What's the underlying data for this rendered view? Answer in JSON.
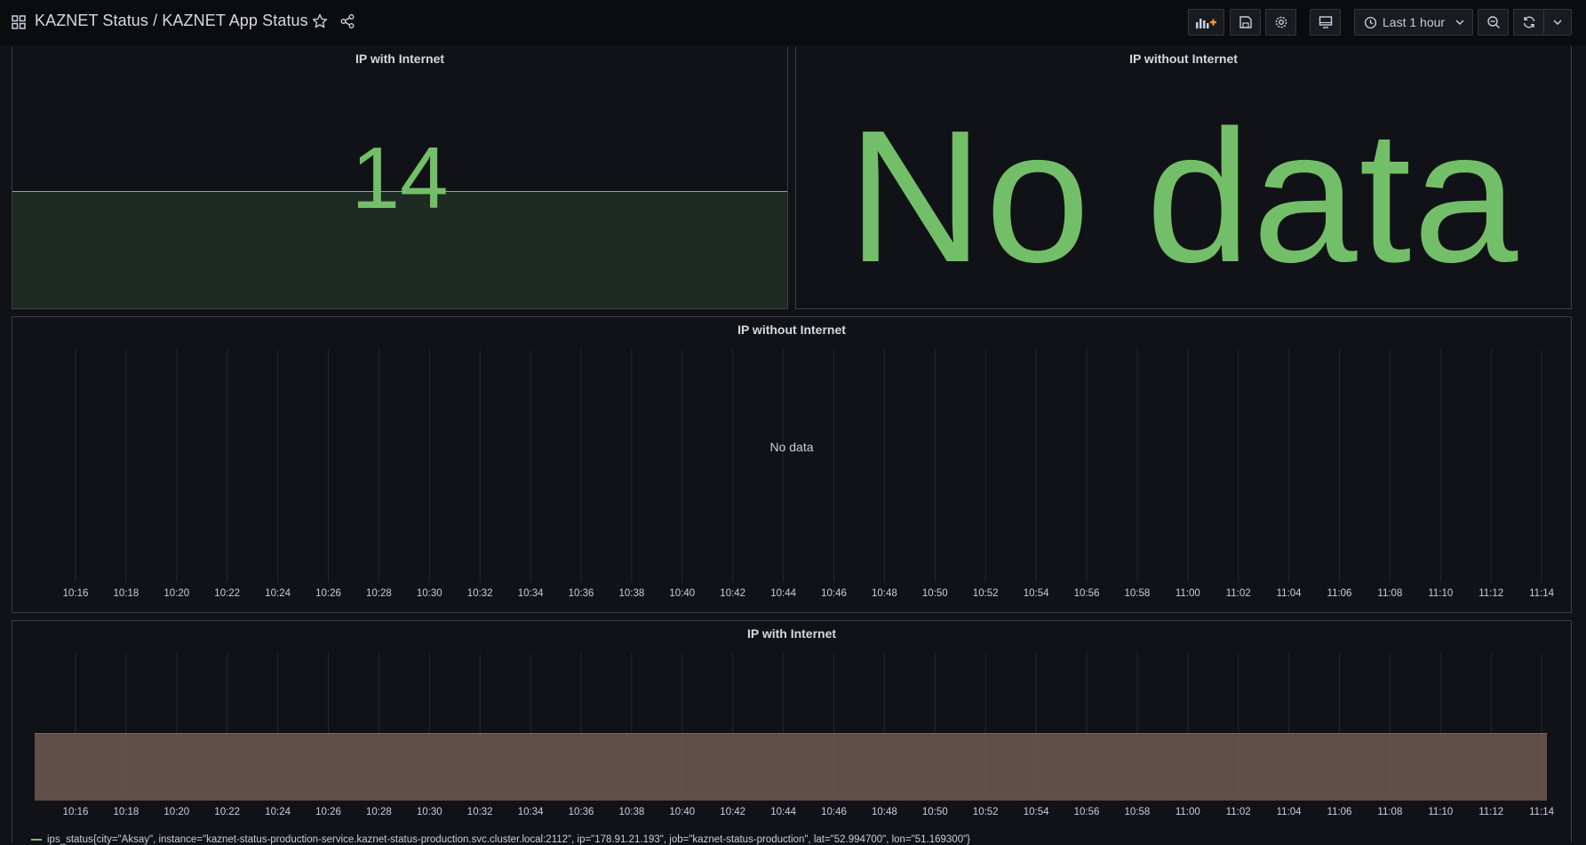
{
  "header": {
    "title": "KAZNET Status / KAZNET App Status",
    "time_range_label": "Last 1 hour",
    "icons": [
      "apps-grid-icon",
      "star-icon",
      "share-icon",
      "add-panel-icon",
      "save-icon",
      "gear-icon",
      "tv-mode-icon",
      "clock-icon",
      "chevron-down-icon",
      "zoom-out-icon",
      "refresh-icon",
      "chevron-down-icon"
    ]
  },
  "panels": {
    "stat_with": {
      "title": "IP with Internet",
      "value": "14"
    },
    "stat_without": {
      "title": "IP without Internet",
      "no_data": "No data"
    },
    "ts_without": {
      "title": "IP without Internet",
      "no_data": "No data"
    },
    "ts_with": {
      "title": "IP with Internet",
      "legend": "ips_status{city=\"Aksay\", instance=\"kaznet-status-production-service.kaznet-status-production.svc.cluster.local:2112\", ip=\"178.91.21.193\", job=\"kaznet-status-production\", lat=\"52.994700\", lon=\"51.169300\"}"
    }
  },
  "x_ticks": [
    "10:16",
    "10:18",
    "10:20",
    "10:22",
    "10:24",
    "10:26",
    "10:28",
    "10:30",
    "10:32",
    "10:34",
    "10:36",
    "10:38",
    "10:40",
    "10:42",
    "10:44",
    "10:46",
    "10:48",
    "10:50",
    "10:52",
    "10:54",
    "10:56",
    "10:58",
    "11:00",
    "11:02",
    "11:04",
    "11:06",
    "11:08",
    "11:10",
    "11:12",
    "11:14"
  ],
  "colors": {
    "accent_green": "#73bf69",
    "area_fill": "#66524c",
    "background": "#111217"
  },
  "chart_data": {
    "type": "area",
    "title": "IP with Internet",
    "x": [
      "10:16",
      "10:18",
      "10:20",
      "10:22",
      "10:24",
      "10:26",
      "10:28",
      "10:30",
      "10:32",
      "10:34",
      "10:36",
      "10:38",
      "10:40",
      "10:42",
      "10:44",
      "10:46",
      "10:48",
      "10:50",
      "10:52",
      "10:54",
      "10:56",
      "10:58",
      "11:00",
      "11:02",
      "11:04",
      "11:06",
      "11:08",
      "11:10",
      "11:12",
      "11:14"
    ],
    "series": [
      {
        "name": "ips_status{city=\"Aksay\", instance=\"kaznet-status-production-service.kaznet-status-production.svc.cluster.local:2112\", ip=\"178.91.21.193\", job=\"kaznet-status-production\", lat=\"52.994700\", lon=\"51.169300\"}",
        "values": [
          1,
          1,
          1,
          1,
          1,
          1,
          1,
          1,
          1,
          1,
          1,
          1,
          1,
          1,
          1,
          1,
          1,
          1,
          1,
          1,
          1,
          1,
          1,
          1,
          1,
          1,
          1,
          1,
          1,
          1
        ]
      }
    ],
    "grid": true
  }
}
